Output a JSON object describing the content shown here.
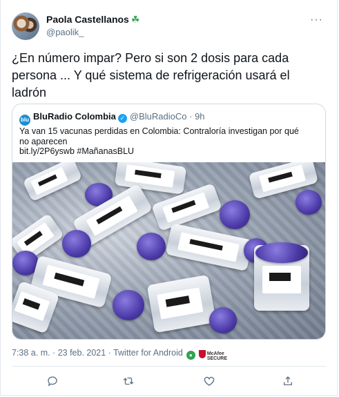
{
  "author": {
    "name": "Paola Castellanos",
    "handle": "@paolik_",
    "emoji": "☘"
  },
  "tweet_text": "¿En número impar? Pero si son 2 dosis para cada persona ... Y qué sistema de refrigeración usará el ladrón",
  "more_label": "···",
  "quoted": {
    "avatar_text": "blu",
    "name": "BluRadio Colombia",
    "handle": "@BluRadioCo",
    "dot": "·",
    "time": "9h",
    "text": "Ya van 15 vacunas perdidas en Colombia: Contraloría investigan por qué no aparecen",
    "link": "bit.ly/2P6yswb #MañanasBLU",
    "verified_icon": "verified-badge"
  },
  "meta": {
    "timestamp": "7:38 a. m. · 23 feb. 2021 · Twitter for Android",
    "mcafee_line1": "McAfee",
    "mcafee_line2": "SECURE"
  },
  "actions": [
    "reply-icon",
    "retweet-icon",
    "like-icon",
    "share-icon"
  ],
  "colors": {
    "accent": "#1da1f2",
    "muted": "#5b7083",
    "border": "#cfd9de",
    "cap": "#4c3aa8"
  }
}
